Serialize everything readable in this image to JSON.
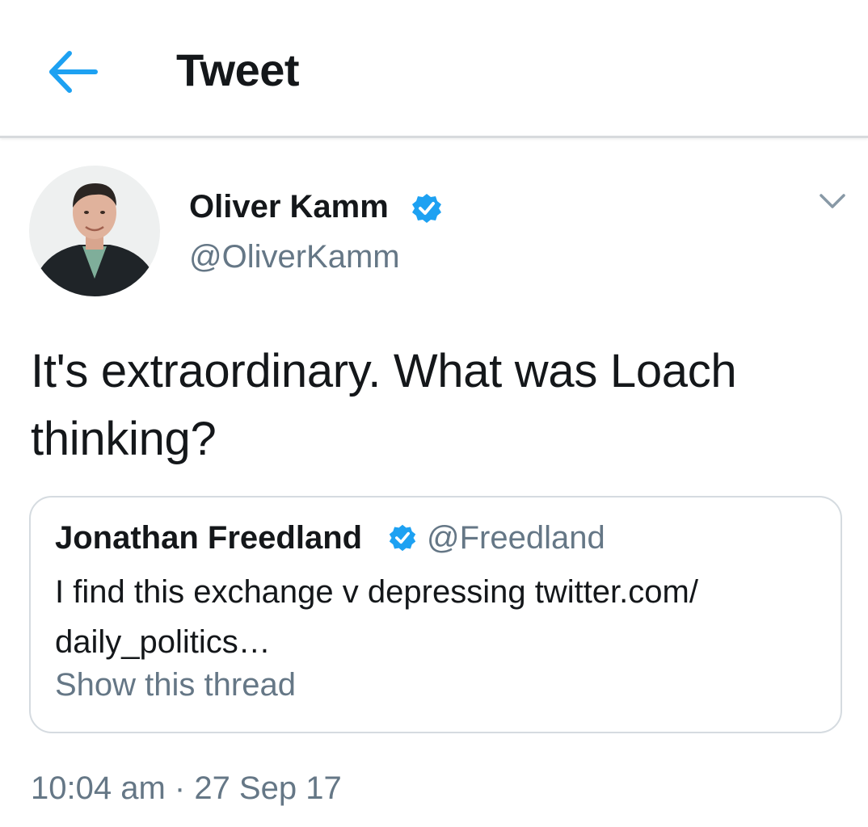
{
  "header": {
    "title": "Tweet",
    "back_icon": "arrow-left-icon"
  },
  "colors": {
    "accent": "#1da1f2",
    "text_primary": "#14171a",
    "text_secondary": "#657786",
    "border": "#d5dbe0"
  },
  "tweet": {
    "author": {
      "name": "Oliver Kamm",
      "handle": "@OliverKamm",
      "verified": true
    },
    "text": "It's extraordinary. What was Loach thinking?",
    "quoted": {
      "name": "Jonathan Freedland",
      "handle": "@Freedland",
      "verified": true,
      "text": "I find this exchange v depressing twitter.com/ daily_politics…",
      "show_thread": "Show this thread"
    },
    "timestamp": "10:04 am · 27 Sep 17"
  }
}
